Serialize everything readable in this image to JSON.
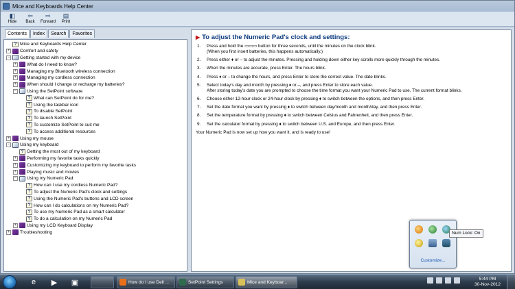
{
  "window": {
    "title": "Mice and Keyboards Help Center"
  },
  "toolbar": {
    "buttons": [
      {
        "label": "Hide",
        "icon": "hide-icon",
        "glyph": "◧"
      },
      {
        "label": "Back",
        "icon": "back-icon",
        "glyph": "⇦"
      },
      {
        "label": "Forward",
        "icon": "forward-icon",
        "glyph": "⇨"
      },
      {
        "label": "Print",
        "icon": "print-icon",
        "glyph": "▤"
      }
    ]
  },
  "tabs": [
    "Contents",
    "Index",
    "Search",
    "Favorites"
  ],
  "tree": [
    {
      "indent": 0,
      "expander": "",
      "icon": "topic",
      "label": "Mice and Keyboards Help Center"
    },
    {
      "indent": 0,
      "expander": "+",
      "icon": "book",
      "label": "Comfort and safety"
    },
    {
      "indent": 0,
      "expander": "−",
      "icon": "openbook",
      "label": "Getting started with my device"
    },
    {
      "indent": 1,
      "expander": "+",
      "icon": "book",
      "label": "What do I need to know?"
    },
    {
      "indent": 1,
      "expander": "+",
      "icon": "book",
      "label": "Managing my Bluetooth wireless connection"
    },
    {
      "indent": 1,
      "expander": "+",
      "icon": "book",
      "label": "Managing my cordless connection"
    },
    {
      "indent": 1,
      "expander": "+",
      "icon": "book",
      "label": "When should I change or recharge my batteries?"
    },
    {
      "indent": 1,
      "expander": "−",
      "icon": "openbook",
      "label": "Using the SetPoint software"
    },
    {
      "indent": 2,
      "expander": "",
      "icon": "topic",
      "label": "What can SetPoint do for me?"
    },
    {
      "indent": 2,
      "expander": "",
      "icon": "topic",
      "label": "Using the taskbar icon"
    },
    {
      "indent": 2,
      "expander": "",
      "icon": "topic",
      "label": "To disable SetPoint"
    },
    {
      "indent": 2,
      "expander": "",
      "icon": "topic",
      "label": "To launch SetPoint"
    },
    {
      "indent": 2,
      "expander": "",
      "icon": "topic",
      "label": "To customize SetPoint to suit me"
    },
    {
      "indent": 2,
      "expander": "",
      "icon": "topic",
      "label": "To access additional resources"
    },
    {
      "indent": 0,
      "expander": "+",
      "icon": "book",
      "label": "Using my mouse"
    },
    {
      "indent": 0,
      "expander": "−",
      "icon": "openbook",
      "label": "Using my keyboard"
    },
    {
      "indent": 1,
      "expander": "",
      "icon": "topic",
      "label": "Getting the most out of my keyboard"
    },
    {
      "indent": 1,
      "expander": "+",
      "icon": "book",
      "label": "Performing my favorite tasks quickly"
    },
    {
      "indent": 1,
      "expander": "+",
      "icon": "book",
      "label": "Customizing my keyboard to perform my favorite tasks"
    },
    {
      "indent": 1,
      "expander": "+",
      "icon": "book",
      "label": "Playing music and movies"
    },
    {
      "indent": 1,
      "expander": "−",
      "icon": "openbook",
      "label": "Using my Numeric Pad"
    },
    {
      "indent": 2,
      "expander": "",
      "icon": "topic",
      "label": "How can I use my cordless Numeric Pad?"
    },
    {
      "indent": 2,
      "expander": "",
      "icon": "topic",
      "label": "To adjust the Numeric Pad's clock and settings"
    },
    {
      "indent": 2,
      "expander": "",
      "icon": "topic",
      "label": "Using the Numeric Pad's buttons and LCD screen"
    },
    {
      "indent": 2,
      "expander": "",
      "icon": "topic",
      "label": "How can I do calculations on my Numeric Pad?"
    },
    {
      "indent": 2,
      "expander": "",
      "icon": "topic",
      "label": "To use my Numeric Pad as a smart calculator"
    },
    {
      "indent": 2,
      "expander": "",
      "icon": "topic",
      "label": "To do a calculation on my Numeric Pad"
    },
    {
      "indent": 1,
      "expander": "+",
      "icon": "book",
      "label": "Using my LCD Keyboard Display"
    },
    {
      "indent": 0,
      "expander": "+",
      "icon": "book",
      "label": "Troubleshooting"
    }
  ],
  "article": {
    "heading": "To adjust the Numeric Pad's clock and settings:",
    "steps": [
      {
        "num": "1.",
        "text": "Press and hold the ▭▭▭ button for three seconds, until the minutes on the clock blink.",
        "note": "(When you first insert batteries, this happens automatically.)"
      },
      {
        "num": "2.",
        "text": "Press either ♦ or – to adjust the minutes. Pressing and holding down either key scrolls more quickly through the minutes.",
        "note": ""
      },
      {
        "num": "3.",
        "text": "When the minutes are accurate, press Enter. The hours blink.",
        "note": ""
      },
      {
        "num": "4.",
        "text": "Press ♦ or – to change the hours, and press Enter to store the correct value. The date blinks.",
        "note": ""
      },
      {
        "num": "5.",
        "text": "Select today's day and month by pressing ♦ or –, and press Enter to store each value.",
        "note": "After storing today's date you are prompted to choose the time format you want your Numeric Pad to use. The current format blinks."
      },
      {
        "num": "6.",
        "text": "Choose either 12-hour clock or 24-hour clock by pressing ♦ to switch between the options, and then press Enter.",
        "note": ""
      },
      {
        "num": "7.",
        "text": "Set the date format you want by pressing ♦ to switch between day/month and month/day, and then press Enter.",
        "note": ""
      },
      {
        "num": "8.",
        "text": "Set the temperature format by pressing ♦ to switch between Celsius and Fahrenheit, and then press Enter.",
        "note": ""
      },
      {
        "num": "9.",
        "text": "Set the calculator format by pressing ♦ to switch between U.S. and Europe, and then press Enter.",
        "note": ""
      }
    ],
    "final": "Your Numeric Pad is now set up how you want it, and is ready to use!"
  },
  "tray_flyout": {
    "icons": [
      "orange-tray-icon",
      "green-tray-icon",
      "green-blue-tray-icon",
      "yellow-tray-icon",
      "network-tray-icon",
      "setpoint-mouse-tray-icon"
    ],
    "customize_label": "Customize...",
    "tooltip": "Num Lock: On"
  },
  "taskbar": {
    "pinned": [
      {
        "name": "internet-explorer-icon",
        "glyph": "e"
      },
      {
        "name": "media-player-icon",
        "glyph": "▶"
      },
      {
        "name": "explorer-folder-icon",
        "glyph": "▣"
      }
    ],
    "tasks": [
      {
        "label": "How do I use Dell ...",
        "icon_color": "#e8701a"
      },
      {
        "label": "SetPoint Settings",
        "icon_color": "#2f6b4e"
      },
      {
        "label": "Mice and Keyboar...",
        "icon_color": "#d9c15a"
      }
    ],
    "clock_time": "5:44 PM",
    "clock_date": "30-Nov-2012"
  },
  "colors": {
    "heading": "#0b3a7e",
    "link": "#1a56b5",
    "book": "#7b3aa1"
  }
}
